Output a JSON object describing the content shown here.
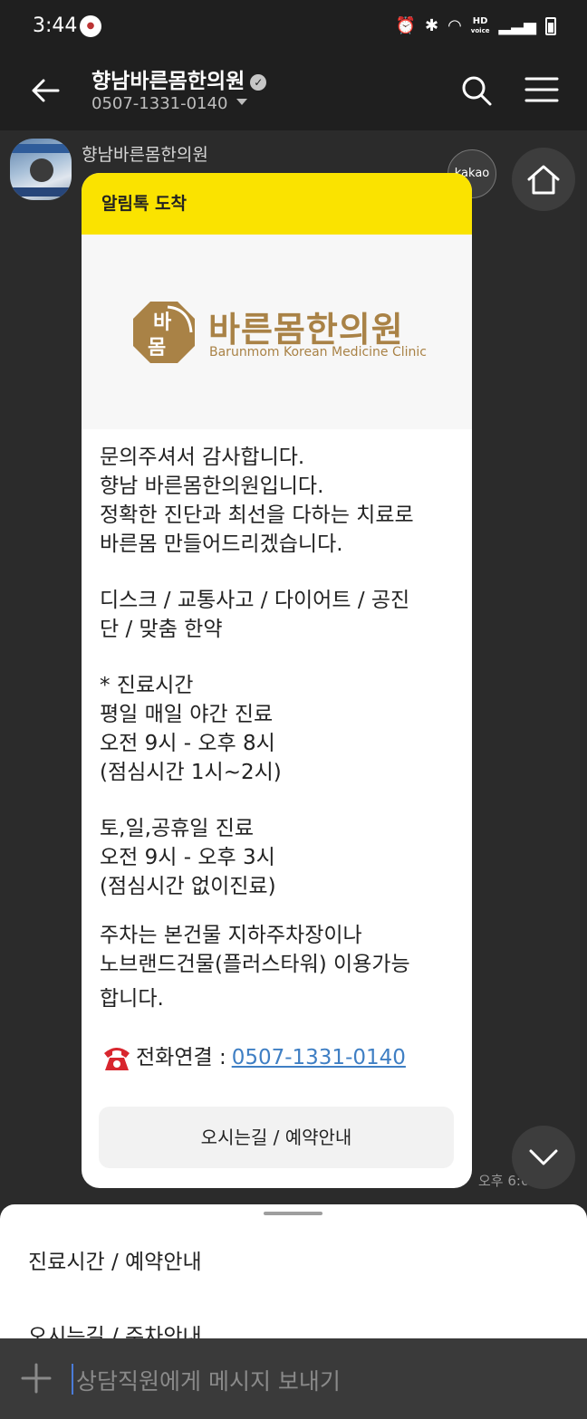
{
  "status_bar": {
    "time": "3:44",
    "app_icon": "app-notification-icon",
    "network": "HD",
    "network_sub": "voice"
  },
  "header": {
    "title": "향남바른몸한의원",
    "phone": "0507-1331-0140"
  },
  "chat": {
    "sender": "향남바른몸한의원",
    "badge": "kakao",
    "card": {
      "header_label": "알림톡 도착",
      "logo_mark_top": "바",
      "logo_mark_bottom": "몸",
      "logo_title": "바른몸한의원",
      "logo_sub": "Barunmom Korean Medicine Clinic",
      "body_lines_1": [
        "문의주셔서 감사합니다.",
        "향남 바른몸한의원입니다.",
        "정확한 진단과 최선을 다하는 치료로",
        "바른몸 만들어드리겠습니다."
      ],
      "body_lines_2": [
        "디스크 / 교통사고 / 다이어트 / 공진",
        "단 / 맞춤 한약"
      ],
      "body_lines_3": [
        "* 진료시간",
        "평일 매일 야간 진료",
        "오전 9시 - 오후 8시",
        "(점심시간 1시~2시)"
      ],
      "body_lines_4": [
        "토,일,공휴일 진료",
        "오전 9시 - 오후 3시",
        "(점심시간 없이진료)"
      ],
      "body_lines_5": [
        "주차는 본건물 지하주차장이나",
        "노브랜드건물(플러스타워) 이용가능",
        "합니다."
      ],
      "tel_label": "전화연결 :",
      "tel_number": "0507-1331-0140",
      "button_label": "오시는길 / 예약안내"
    },
    "time": "오후 6:0"
  },
  "bottom_menu": {
    "items": [
      "진료시간 / 예약안내",
      "오시는길 / 주차안내"
    ]
  },
  "input": {
    "placeholder": "상담직원에게 메시지 보내기"
  },
  "colors": {
    "kakao_yellow": "#fae300",
    "brand_gold": "#a98246",
    "link_blue": "#3f7fc4",
    "dark_bg": "#2b2b2b"
  }
}
